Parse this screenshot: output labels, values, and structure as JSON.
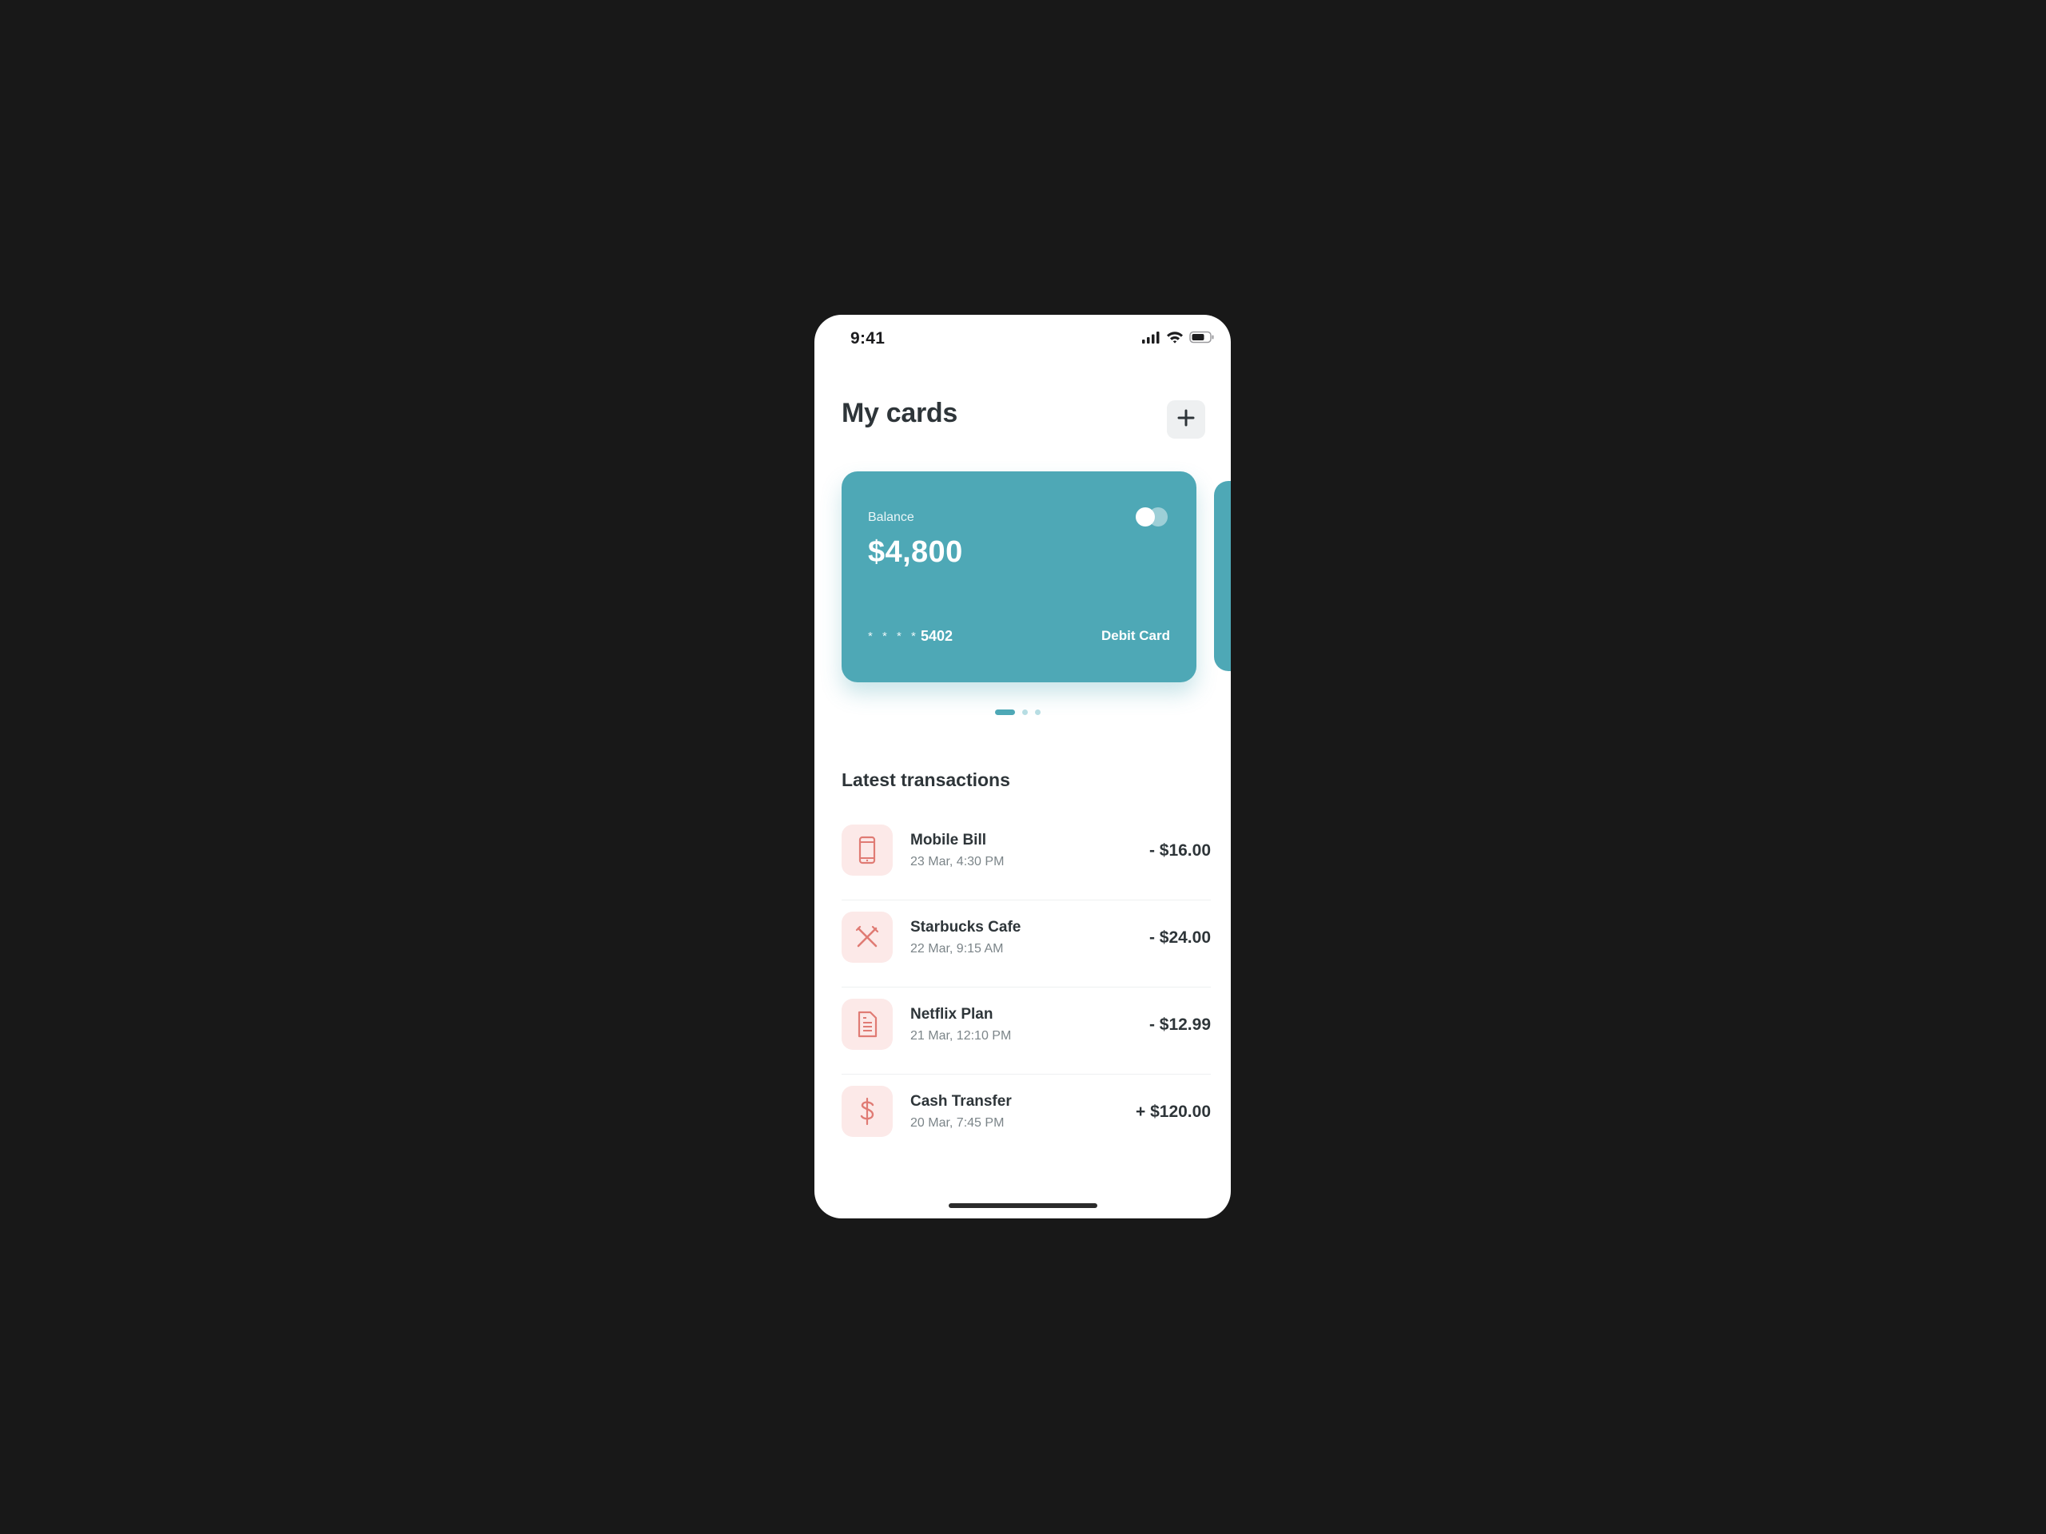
{
  "status_bar": {
    "time": "9:41",
    "icons": [
      "cellular-signal-icon",
      "wifi-icon",
      "battery-icon"
    ]
  },
  "header": {
    "title": "My cards",
    "add_icon": "plus-icon"
  },
  "card": {
    "balance_label": "Balance",
    "balance": "$4,800",
    "masked_digits": "* * * *",
    "last4": "5402",
    "type": "Debit Card",
    "color": "#4ea8b6"
  },
  "pager": {
    "count": 3,
    "active_index": 0
  },
  "transactions": {
    "title": "Latest transactions",
    "items": [
      {
        "name": "Mobile Bill",
        "date": "23 Mar, 4:30 PM",
        "amount": "- $16.00",
        "icon": "mobile-phone-icon"
      },
      {
        "name": "Starbucks Cafe",
        "date": "22 Mar, 9:15 AM",
        "amount": "- $24.00",
        "icon": "utensils-icon"
      },
      {
        "name": "Netflix Plan",
        "date": "21 Mar, 12:10 PM",
        "amount": "- $12.99",
        "icon": "document-icon"
      },
      {
        "name": "Cash Transfer",
        "date": "20 Mar, 7:45 PM",
        "amount": "+ $120.00",
        "icon": "dollar-icon"
      }
    ]
  },
  "colors": {
    "accent": "#4ea8b6",
    "icon_tint": "#e07b74",
    "icon_background": "#fce9e8",
    "text_primary": "#2e3539",
    "text_secondary": "#7c8589"
  }
}
